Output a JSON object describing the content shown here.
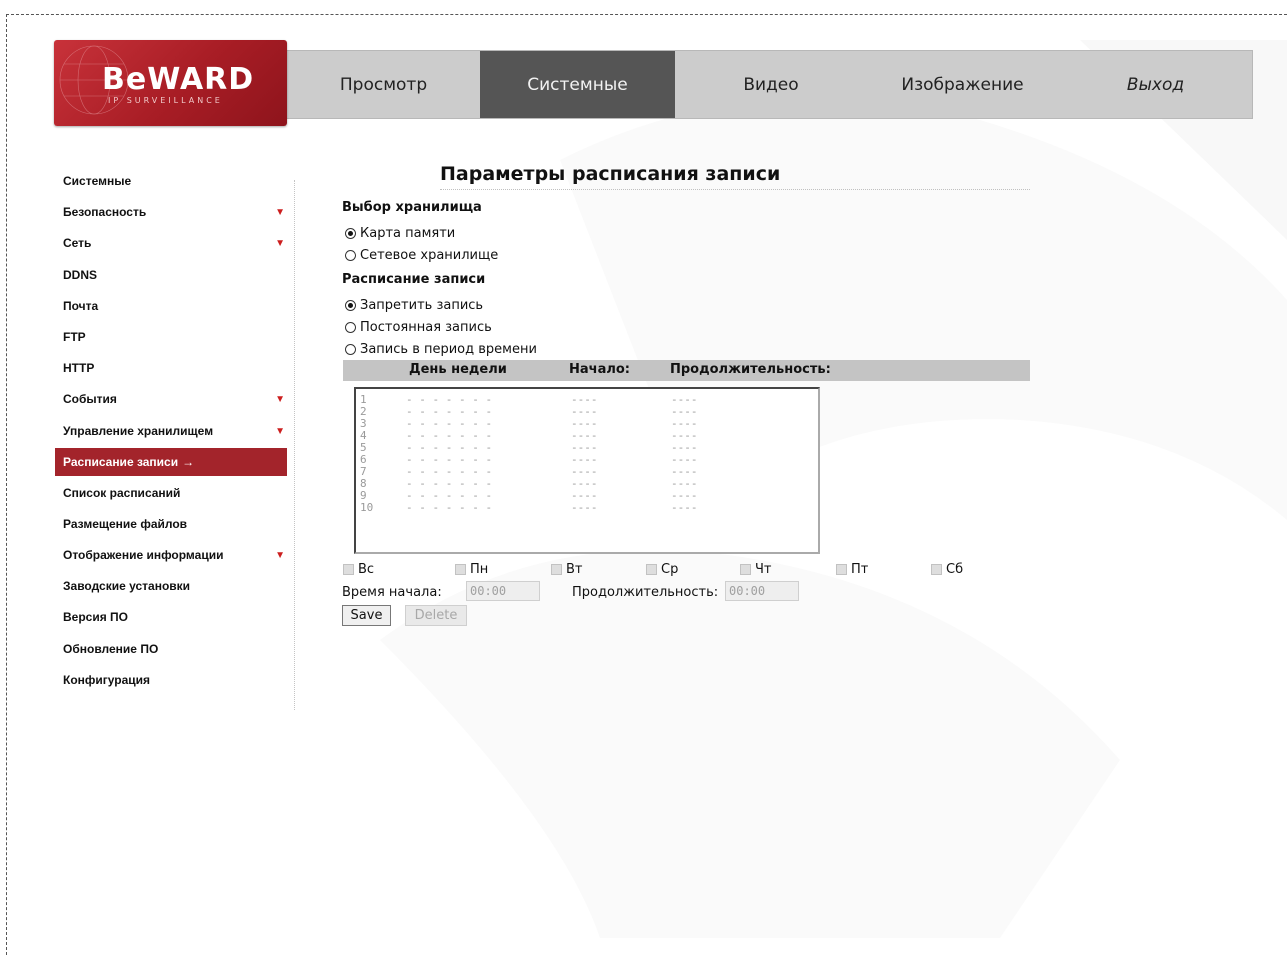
{
  "brand": {
    "name": "BeWARD",
    "tagline": "IP SURVEILLANCE",
    "accent": "#a3242b"
  },
  "nav": {
    "items": [
      {
        "label": "Просмотр"
      },
      {
        "label": "Системные"
      },
      {
        "label": "Видео"
      },
      {
        "label": "Изображение"
      },
      {
        "label": "Выход"
      }
    ],
    "active": "Системные"
  },
  "sidebar": {
    "items": [
      {
        "label": "Системные"
      },
      {
        "label": "Безопасность"
      },
      {
        "label": "Сеть"
      },
      {
        "label": "DDNS"
      },
      {
        "label": "Почта"
      },
      {
        "label": "FTP"
      },
      {
        "label": "HTTP"
      },
      {
        "label": "События"
      },
      {
        "label": "Управление хранилищем"
      },
      {
        "label": "Расписание записи",
        "active_marker": "→"
      },
      {
        "label": "Список расписаний"
      },
      {
        "label": "Размещение файлов"
      },
      {
        "label": "Отображение информации"
      },
      {
        "label": "Заводские установки"
      },
      {
        "label": "Версия ПО"
      },
      {
        "label": "Обновление ПО"
      },
      {
        "label": "Конфигурация"
      }
    ],
    "active": "Расписание записи",
    "expand_marker": "▼"
  },
  "page": {
    "title": "Параметры расписания записи",
    "storage": {
      "heading": "Выбор хранилища",
      "options": [
        "Карта памяти",
        "Сетевое хранилище"
      ],
      "selected": "Карта памяти"
    },
    "schedule": {
      "heading": "Расписание записи",
      "options": [
        "Запретить запись",
        "Постоянная запись",
        "Запись в период времени"
      ],
      "selected": "Запретить запись"
    },
    "table": {
      "columns": [
        "День недели",
        "Начало:",
        "Продолжительность:"
      ],
      "rows": [
        {
          "n": "1",
          "days": "- - - - - - -",
          "start": "----",
          "duration": "----"
        },
        {
          "n": "2",
          "days": "- - - - - - -",
          "start": "----",
          "duration": "----"
        },
        {
          "n": "3",
          "days": "- - - - - - -",
          "start": "----",
          "duration": "----"
        },
        {
          "n": "4",
          "days": "- - - - - - -",
          "start": "----",
          "duration": "----"
        },
        {
          "n": "5",
          "days": "- - - - - - -",
          "start": "----",
          "duration": "----"
        },
        {
          "n": "6",
          "days": "- - - - - - -",
          "start": "----",
          "duration": "----"
        },
        {
          "n": "7",
          "days": "- - - - - - -",
          "start": "----",
          "duration": "----"
        },
        {
          "n": "8",
          "days": "- - - - - - -",
          "start": "----",
          "duration": "----"
        },
        {
          "n": "9",
          "days": "- - - - - - -",
          "start": "----",
          "duration": "----"
        },
        {
          "n": "10",
          "days": "- - - - - - -",
          "start": "----",
          "duration": "----"
        }
      ]
    },
    "weekdays": [
      "Вс",
      "Пн",
      "Вт",
      "Ср",
      "Чт",
      "Пт",
      "Сб"
    ],
    "start_time": {
      "label": "Время начала:",
      "value": "00:00"
    },
    "duration": {
      "label": "Продолжительность:",
      "value": "00:00"
    },
    "buttons": {
      "save": "Save",
      "delete": "Delete"
    }
  }
}
